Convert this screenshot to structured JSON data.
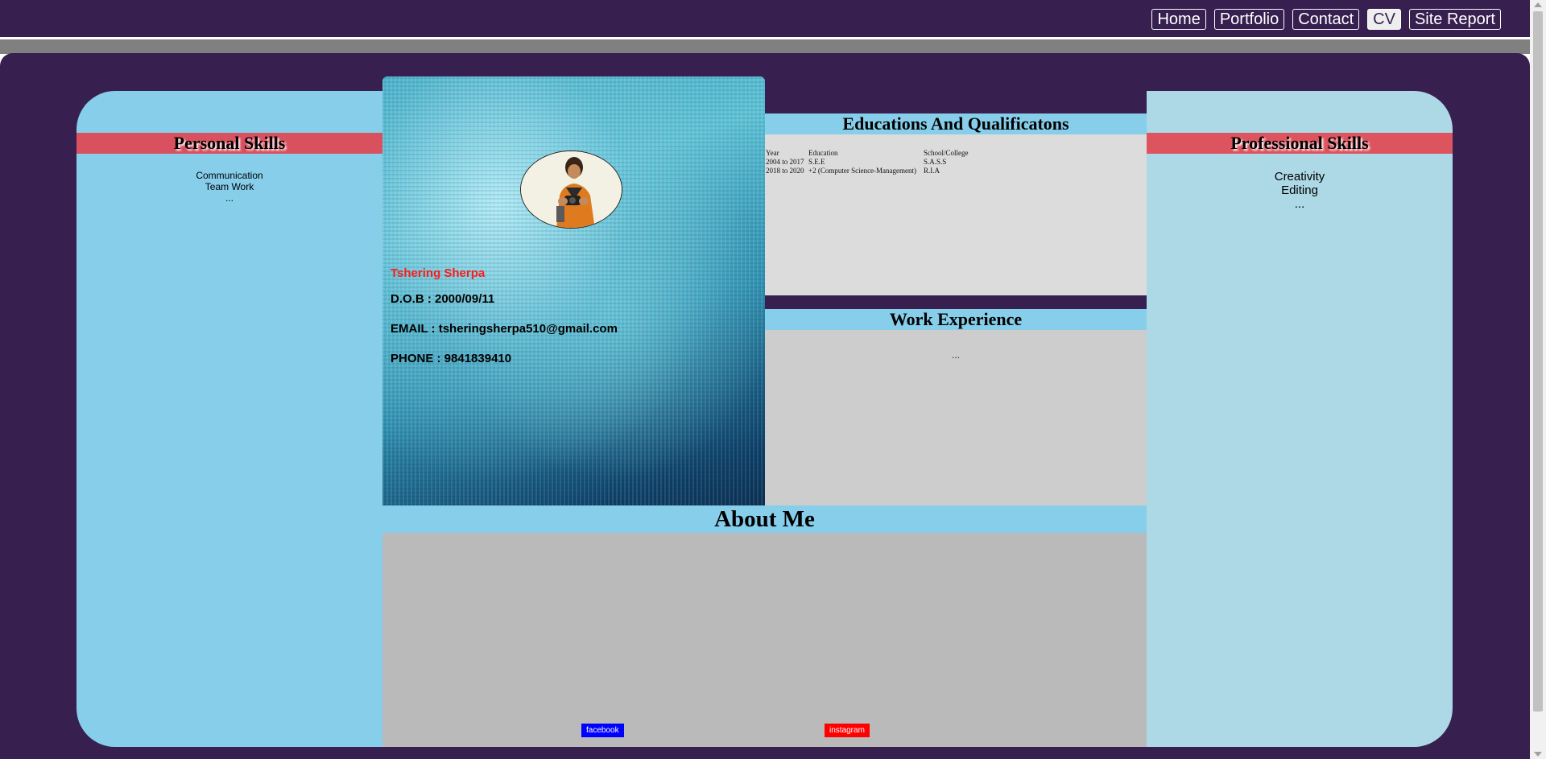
{
  "nav": {
    "items": [
      {
        "label": "Home",
        "active": false
      },
      {
        "label": "Portfolio",
        "active": false
      },
      {
        "label": "Contact",
        "active": false
      },
      {
        "label": "CV",
        "active": true
      },
      {
        "label": "Site Report",
        "active": false
      }
    ]
  },
  "personal_skills": {
    "heading": "Personal Skills",
    "items": [
      "Communication",
      "Team Work",
      "..."
    ]
  },
  "professional_skills": {
    "heading": "Professional Skills",
    "items": [
      "Creativity",
      "Editing",
      "..."
    ]
  },
  "profile": {
    "name": "Tshering Sherpa",
    "dob": "D.O.B : 2000/09/11",
    "email": "EMAIL : tsheringsherpa510@gmail.com",
    "phone": "PHONE : 9841839410"
  },
  "education": {
    "heading": "Educations And Qualificatons",
    "columns": [
      "Year",
      "Education",
      "School/College"
    ],
    "rows": [
      [
        "2004 to 2017",
        "S.E.E",
        "S.A.S.S"
      ],
      [
        "2018 to 2020",
        "+2 (Computer Science-Management)",
        "R.I.A"
      ]
    ]
  },
  "work": {
    "heading": "Work Experience",
    "text": "..."
  },
  "about": {
    "heading": "About Me",
    "facebook_label": "facebook",
    "instagram_label": "instagram"
  },
  "colors": {
    "background": "#371f4f",
    "panel_left": "#87ceeb",
    "panel_right": "#add8e6",
    "skill_heading": "#d9505f",
    "name_red": "#ff1a1a"
  }
}
